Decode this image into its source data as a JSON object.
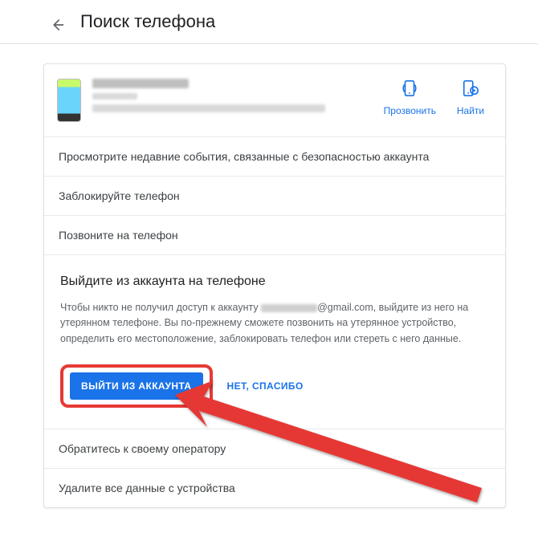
{
  "header": {
    "title": "Поиск телефона"
  },
  "device": {
    "ring_label": "Прозвонить",
    "find_label": "Найти"
  },
  "rows": {
    "security_events": "Просмотрите недавние события, связанные с безопасностью аккаунта",
    "lock_phone": "Заблокируйте телефон",
    "call_phone": "Позвоните на телефон",
    "contact_carrier": "Обратитесь к своему оператору",
    "erase_device": "Удалите все данные с устройства"
  },
  "signout": {
    "title": "Выйдите из аккаунта на телефоне",
    "desc_before": "Чтобы никто не получил доступ к аккаунту ",
    "desc_email_suffix": "@gmail.com, выйдите из него на утерянном телефоне. Вы по-прежнему сможете позвонить на утерянное устройство, определить его местоположение, заблокировать телефон или стереть с него данные.",
    "primary_btn": "Выйти из аккаунта",
    "secondary_btn": "Нет, спасибо"
  }
}
